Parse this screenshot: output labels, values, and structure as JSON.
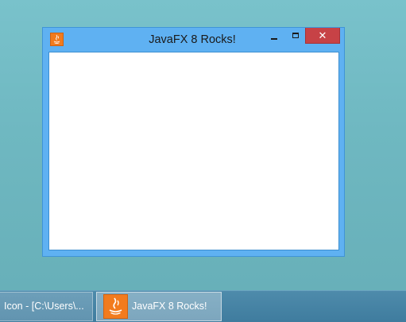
{
  "window": {
    "title": "JavaFX 8 Rocks!",
    "close_glyph": "✕",
    "app_icon": "java-cup-icon"
  },
  "taskbar": {
    "items": [
      {
        "label": "Icon - [C:\\Users\\...",
        "active": false
      },
      {
        "label": "JavaFX 8 Rocks!",
        "active": true,
        "icon": "java-cup-icon"
      }
    ]
  },
  "colors": {
    "desktop": "#6fb8c1",
    "window_frame": "#5fb1f2",
    "close_button": "#c74246",
    "taskbar": "#4581a3",
    "java_icon": "#f27b1e"
  }
}
